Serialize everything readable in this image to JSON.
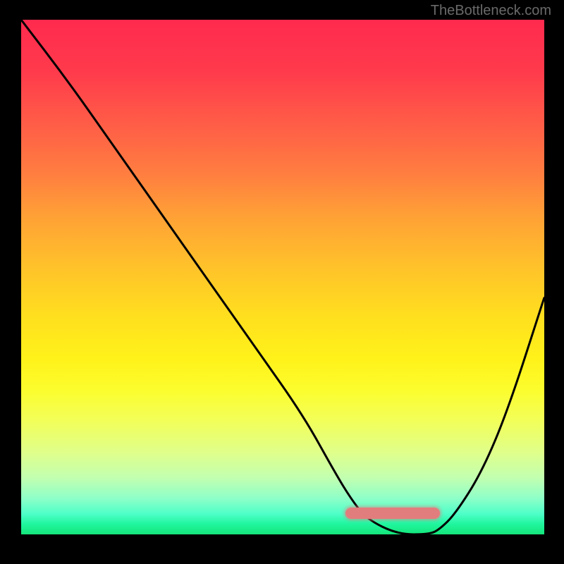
{
  "watermark": "TheBottleneck.com",
  "chart_data": {
    "type": "line",
    "title": "",
    "xlabel": "",
    "ylabel": "",
    "xlim": [
      0,
      100
    ],
    "ylim": [
      0,
      100
    ],
    "series": [
      {
        "name": "curve",
        "x": [
          0,
          9,
          18,
          27,
          36,
          45,
          54,
          60,
          63,
          66,
          72,
          78,
          80,
          83,
          88,
          93,
          100
        ],
        "values": [
          100,
          88,
          75,
          62,
          49,
          36,
          23,
          12,
          7,
          3,
          0,
          0,
          1,
          4,
          12,
          24,
          46
        ]
      }
    ],
    "optimal_band": {
      "x_start": 62,
      "x_end": 80
    }
  }
}
